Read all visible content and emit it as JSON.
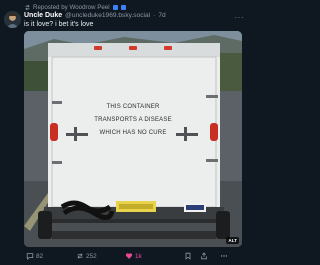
{
  "repost": {
    "text": "Reposted by Woodrow Peel"
  },
  "author": {
    "display_name": "Uncle Duke",
    "handle": "@uncleduke1969.bsky.social",
    "separator": "·",
    "time": "7d"
  },
  "post": {
    "text": "is it love? i bet it's love",
    "image": {
      "sign_lines": [
        "THIS CONTAINER",
        "TRANSPORTS A DISEASE",
        "WHICH HAS NO CURE"
      ],
      "alt_badge": "ALT"
    }
  },
  "actions": {
    "replies": "82",
    "reposts": "252",
    "likes": "1k"
  },
  "colors": {
    "background": "#0f1720",
    "like_accent": "#ec4899",
    "muted": "#8b98a5"
  }
}
